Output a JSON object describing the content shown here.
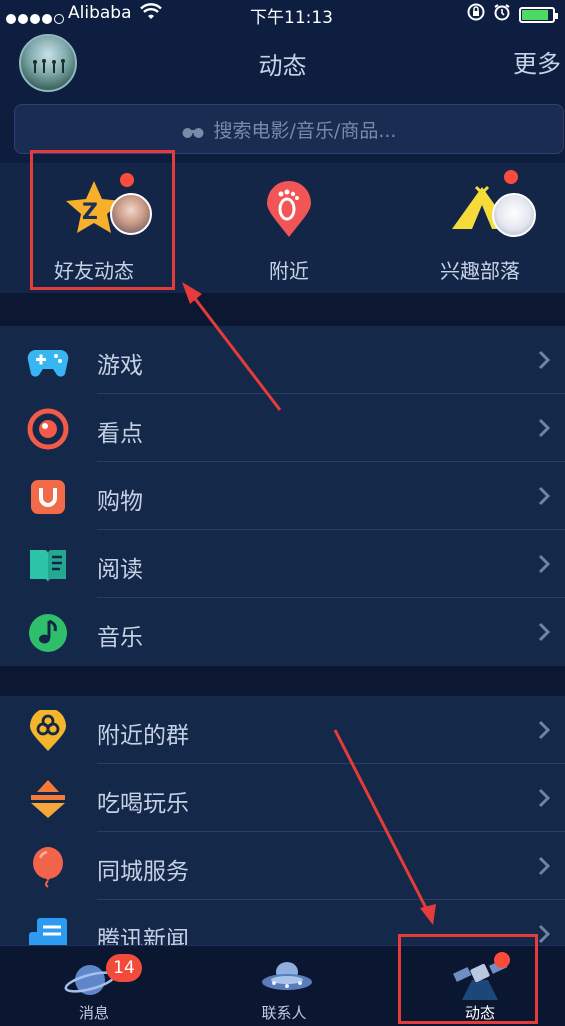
{
  "status_bar": {
    "carrier": "Alibaba",
    "time": "下午11:13",
    "battery_level": 0.85
  },
  "nav": {
    "title": "动态",
    "more": "更多"
  },
  "search": {
    "placeholder": "搜索电影/音乐/商品..."
  },
  "tiles": [
    {
      "label": "好友动态",
      "icon": "qzone-star-icon",
      "has_dot": true
    },
    {
      "label": "附近",
      "icon": "footprint-pin-icon",
      "has_dot": false
    },
    {
      "label": "兴趣部落",
      "icon": "tent-icon",
      "has_dot": true
    }
  ],
  "section1": [
    {
      "label": "游戏",
      "icon": "gamepad-icon"
    },
    {
      "label": "看点",
      "icon": "eye-circle-icon"
    },
    {
      "label": "购物",
      "icon": "shopping-bag-icon"
    },
    {
      "label": "阅读",
      "icon": "book-icon"
    },
    {
      "label": "音乐",
      "icon": "music-note-icon"
    }
  ],
  "section2": [
    {
      "label": "附近的群",
      "icon": "group-pin-icon"
    },
    {
      "label": "吃喝玩乐",
      "icon": "food-icon"
    },
    {
      "label": "同城服务",
      "icon": "balloon-icon"
    },
    {
      "label": "腾讯新闻",
      "icon": "news-icon"
    }
  ],
  "tab_bar": [
    {
      "label": "消息",
      "icon": "planet-icon",
      "badge": "14"
    },
    {
      "label": "联系人",
      "icon": "ufo-icon"
    },
    {
      "label": "动态",
      "icon": "satellite-icon",
      "has_dot": true
    }
  ],
  "colors": {
    "background": "#0d1b3a",
    "accent_red": "#fb4b3a",
    "annotation": "#e53b3b"
  }
}
